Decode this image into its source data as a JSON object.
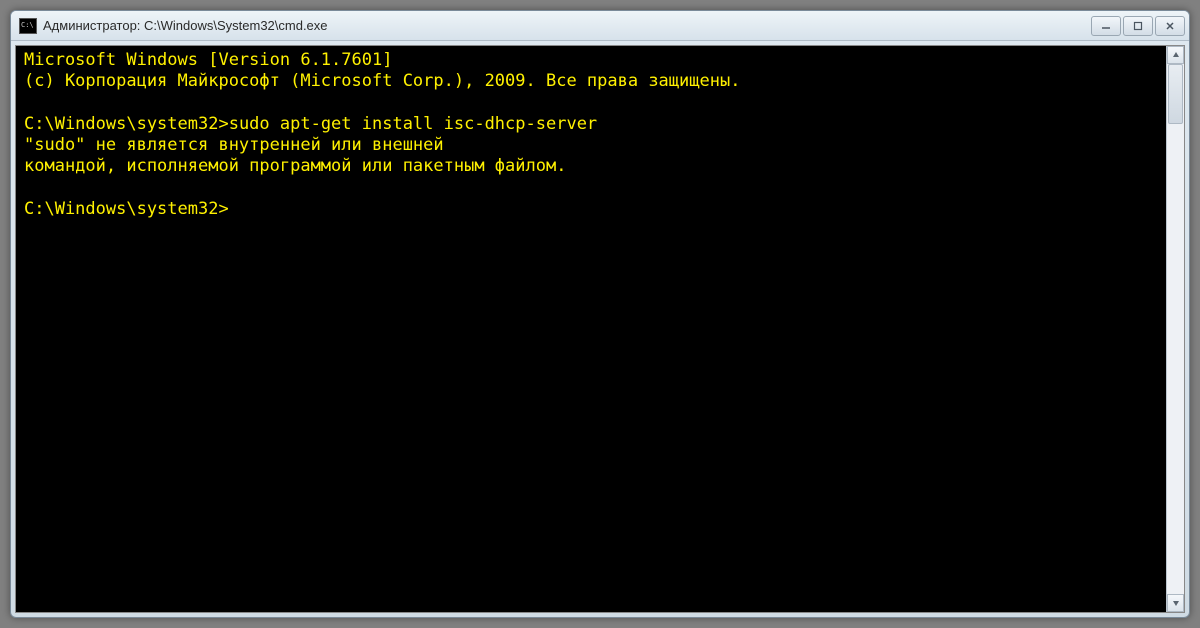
{
  "window": {
    "title": "Администратор: C:\\Windows\\System32\\cmd.exe"
  },
  "terminal": {
    "banner_line1": "Microsoft Windows [Version 6.1.7601]",
    "banner_line2": "(c) Корпорация Майкрософт (Microsoft Corp.), 2009. Все права защищены.",
    "prompt1": "C:\\Windows\\system32>",
    "command1": "sudo apt-get install isc-dhcp-server",
    "error_line1": "\"sudo\" не является внутренней или внешней",
    "error_line2": "командой, исполняемой программой или пакетным файлом.",
    "prompt2": "C:\\Windows\\system32>"
  },
  "colors": {
    "terminal_bg": "#000000",
    "terminal_fg": "#fff100"
  }
}
